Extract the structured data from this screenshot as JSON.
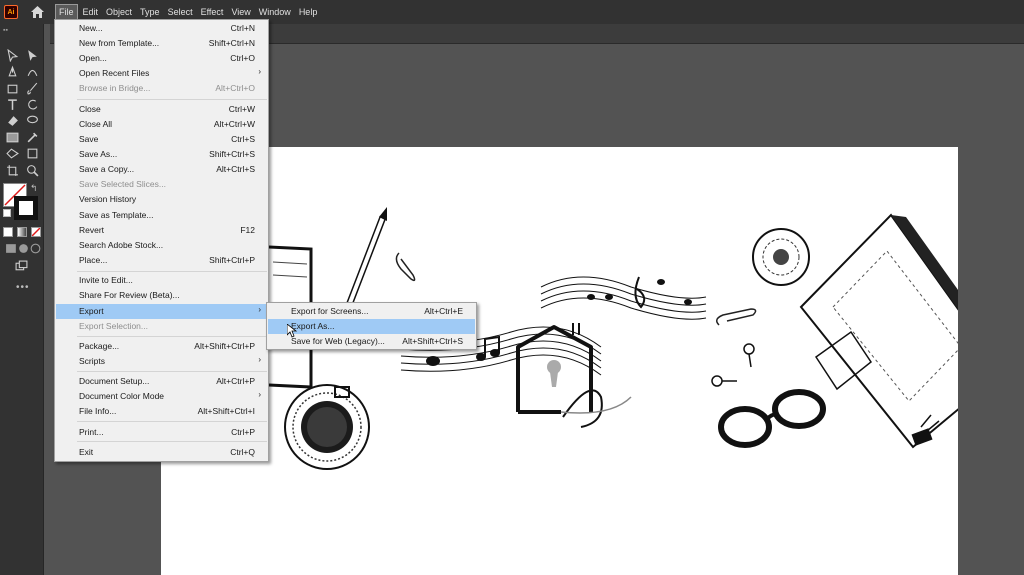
{
  "app": {
    "logo": "Ai"
  },
  "menubar": {
    "items": [
      "File",
      "Edit",
      "Object",
      "Type",
      "Select",
      "Effect",
      "View",
      "Window",
      "Help"
    ],
    "active": "File"
  },
  "file_menu": {
    "items": [
      {
        "label": "New...",
        "shortcut": "Ctrl+N"
      },
      {
        "label": "New from Template...",
        "shortcut": "Shift+Ctrl+N"
      },
      {
        "label": "Open...",
        "shortcut": "Ctrl+O"
      },
      {
        "label": "Open Recent Files",
        "shortcut": ""
      },
      {
        "label": "Browse in Bridge...",
        "shortcut": "Alt+Ctrl+O"
      },
      {
        "label": "Close",
        "shortcut": "Ctrl+W"
      },
      {
        "label": "Close All",
        "shortcut": "Alt+Ctrl+W"
      },
      {
        "label": "Save",
        "shortcut": "Ctrl+S"
      },
      {
        "label": "Save As...",
        "shortcut": "Shift+Ctrl+S"
      },
      {
        "label": "Save a Copy...",
        "shortcut": "Alt+Ctrl+S"
      },
      {
        "label": "Save Selected Slices...",
        "shortcut": ""
      },
      {
        "label": "Version History",
        "shortcut": ""
      },
      {
        "label": "Save as Template...",
        "shortcut": ""
      },
      {
        "label": "Revert",
        "shortcut": "F12"
      },
      {
        "label": "Search Adobe Stock...",
        "shortcut": ""
      },
      {
        "label": "Place...",
        "shortcut": "Shift+Ctrl+P"
      },
      {
        "label": "Invite to Edit...",
        "shortcut": ""
      },
      {
        "label": "Share For Review (Beta)...",
        "shortcut": ""
      },
      {
        "label": "Export",
        "shortcut": ""
      },
      {
        "label": "Export Selection...",
        "shortcut": ""
      },
      {
        "label": "Package...",
        "shortcut": "Alt+Shift+Ctrl+P"
      },
      {
        "label": "Scripts",
        "shortcut": ""
      },
      {
        "label": "Document Setup...",
        "shortcut": "Alt+Ctrl+P"
      },
      {
        "label": "Document Color Mode",
        "shortcut": ""
      },
      {
        "label": "File Info...",
        "shortcut": "Alt+Shift+Ctrl+I"
      },
      {
        "label": "Print...",
        "shortcut": "Ctrl+P"
      },
      {
        "label": "Exit",
        "shortcut": "Ctrl+Q"
      }
    ]
  },
  "export_submenu": {
    "items": [
      {
        "label": "Export for Screens...",
        "shortcut": "Alt+Ctrl+E"
      },
      {
        "label": "Export As...",
        "shortcut": ""
      },
      {
        "label": "Save for Web (Legacy)...",
        "shortcut": "Alt+Shift+Ctrl+S"
      }
    ]
  },
  "colors": {
    "highlight": "#9fcaf5",
    "menu_bg": "#f0f0f0",
    "chrome": "#323232",
    "canvas": "#535353"
  }
}
